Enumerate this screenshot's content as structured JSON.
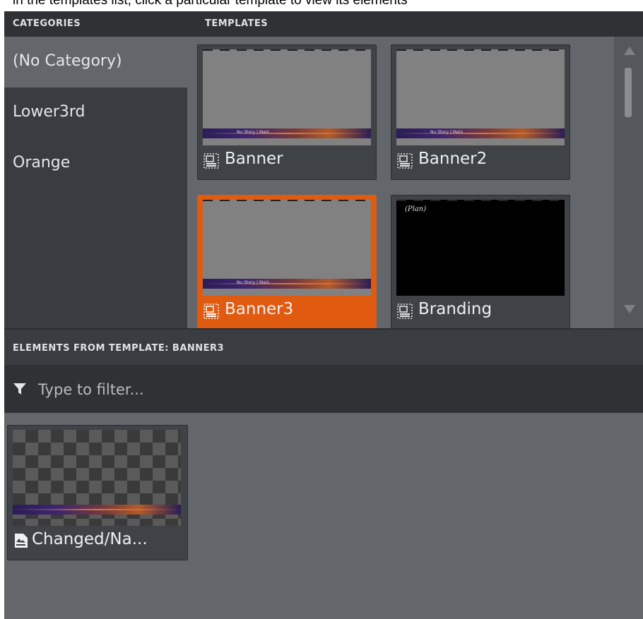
{
  "top_caption": "in the templates list, click a particular template to view its elements",
  "headers": {
    "categories": "CATEGORIES",
    "templates": "TEMPLATES"
  },
  "categories": [
    {
      "label": "(No Category)",
      "selected": true
    },
    {
      "label": "Lower3rd",
      "selected": false
    },
    {
      "label": "Orange",
      "selected": false
    }
  ],
  "templates": [
    {
      "label": "Banner",
      "icon": "template-icon",
      "selected": false,
      "thumb_text": "Nu Story | Main"
    },
    {
      "label": "Banner2",
      "icon": "template-icon",
      "selected": false,
      "thumb_text": "Nu Story | Main"
    },
    {
      "label": "Banner3",
      "icon": "template-icon",
      "selected": true,
      "thumb_text": "Nu Story | Main"
    },
    {
      "label": "Branding",
      "icon": "template-icon",
      "selected": false,
      "thumb_text": "(Plan)"
    }
  ],
  "elements_header": "ELEMENTS FROM TEMPLATE: BANNER3",
  "filter": {
    "placeholder": "Type to filter...",
    "value": "",
    "icon": "filter-icon"
  },
  "elements": [
    {
      "label": "Changed/Na...",
      "icon": "element-icon"
    }
  ],
  "colors": {
    "selection": "#e05a10",
    "panel_dark": "#2f3235",
    "panel": "#63676b"
  }
}
